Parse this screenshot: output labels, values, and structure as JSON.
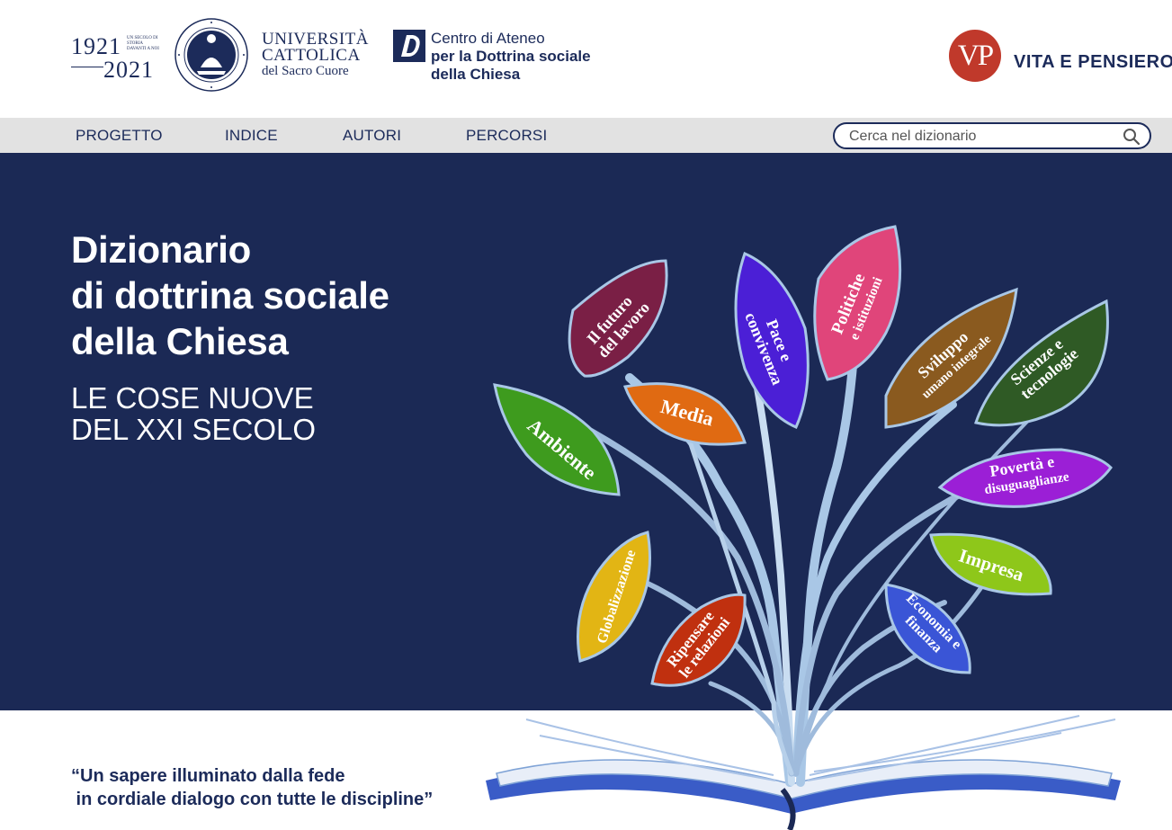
{
  "header": {
    "anniversary": {
      "start_year": "1921",
      "end_year": "2021",
      "motto": "UN SECOLO DI STORIA DAVANTI A NOI"
    },
    "university": {
      "line1": "UNIVERSITÀ",
      "line2": "CATTOLICA",
      "line3": "del Sacro Cuore"
    },
    "centro": {
      "line1": "Centro di Ateneo",
      "line2": "per la Dottrina sociale",
      "line3": "della Chiesa"
    },
    "publisher": {
      "monogram": "VP",
      "name": "VITA E PENSIERO"
    }
  },
  "nav": {
    "items": [
      "PROGETTO",
      "INDICE",
      "AUTORI",
      "PERCORSI"
    ],
    "search_placeholder": "Cerca nel dizionario"
  },
  "hero": {
    "title_line1": "Dizionario",
    "title_line2": "di dottrina sociale",
    "title_line3": "della Chiesa",
    "subtitle_line1": "LE COSE NUOVE",
    "subtitle_line2": "DEL XXI SECOLO"
  },
  "tree": {
    "leaves": [
      {
        "line1": "Il futuro",
        "line2": "del lavoro",
        "color": "#7a1f45"
      },
      {
        "line1": "Pace e",
        "line2": "convivenza",
        "color": "#4b1fd6"
      },
      {
        "line1": "Politiche",
        "line2": "e istituzioni",
        "color": "#e0457a"
      },
      {
        "line1": "Sviluppo",
        "line2": "umano integrale",
        "color": "#8a5a1f"
      },
      {
        "line1": "Scienze e",
        "line2": "tecnologie",
        "color": "#2f5a25"
      },
      {
        "line1": "Media",
        "line2": "",
        "color": "#e06a12"
      },
      {
        "line1": "Ambiente",
        "line2": "",
        "color": "#3e9b1e"
      },
      {
        "line1": "Povertà e",
        "line2": "disuguaglianze",
        "color": "#9b1fd6"
      },
      {
        "line1": "Impresa",
        "line2": "",
        "color": "#8ec71a"
      },
      {
        "line1": "Globalizzazione",
        "line2": "",
        "color": "#e2b514"
      },
      {
        "line1": "Ripensare",
        "line2": "le relazioni",
        "color": "#c0300f"
      },
      {
        "line1": "Economia e",
        "line2": "finanza",
        "color": "#3a55d6"
      }
    ]
  },
  "quote": {
    "line1": "“Un sapere illuminato dalla fede",
    "line2": " in cordiale dialogo con tutte le discipline”"
  },
  "colors": {
    "brand_navy": "#1b2955",
    "nav_bg": "#e2e2e2",
    "vp_red": "#c0392b"
  }
}
